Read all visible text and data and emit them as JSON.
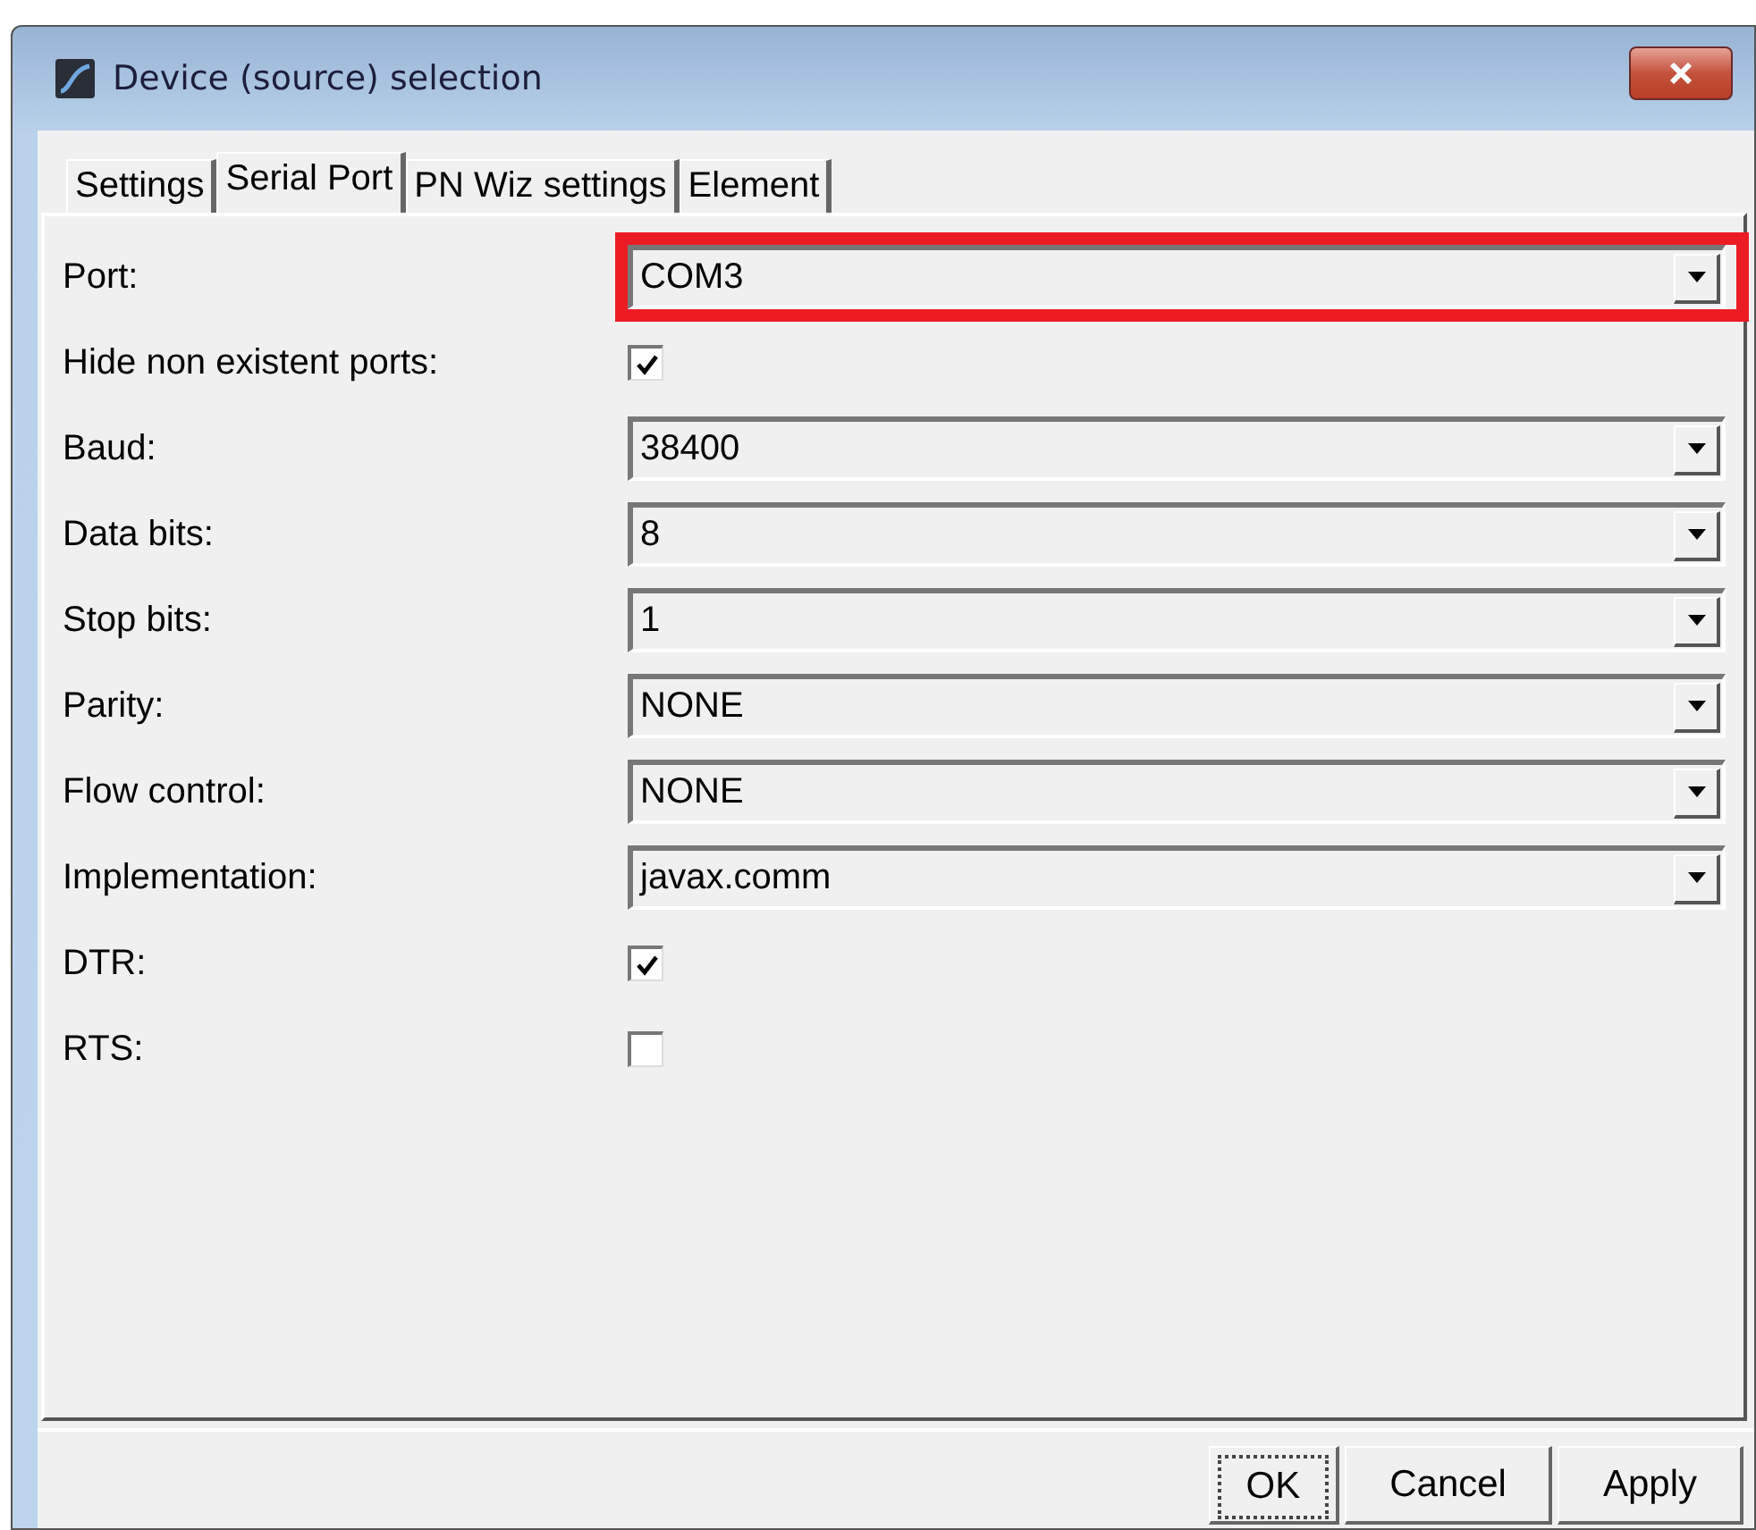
{
  "window": {
    "title": "Device (source) selection"
  },
  "tabs": [
    {
      "label": "Settings",
      "selected": false
    },
    {
      "label": "Serial Port",
      "selected": true
    },
    {
      "label": "PN Wiz settings",
      "selected": false
    },
    {
      "label": "Element",
      "selected": false
    }
  ],
  "fields": [
    {
      "kind": "dropdown",
      "label": "Port:",
      "value": "COM3",
      "highlighted": true
    },
    {
      "kind": "checkbox",
      "label": "Hide non existent ports:",
      "checked": true
    },
    {
      "kind": "dropdown",
      "label": "Baud:",
      "value": "38400",
      "highlighted": false
    },
    {
      "kind": "dropdown",
      "label": "Data bits:",
      "value": "8",
      "highlighted": false
    },
    {
      "kind": "dropdown",
      "label": "Stop bits:",
      "value": "1",
      "highlighted": false
    },
    {
      "kind": "dropdown",
      "label": "Parity:",
      "value": "NONE",
      "highlighted": false
    },
    {
      "kind": "dropdown",
      "label": "Flow control:",
      "value": "NONE",
      "highlighted": false
    },
    {
      "kind": "dropdown",
      "label": "Implementation:",
      "value": "javax.comm",
      "highlighted": false
    },
    {
      "kind": "checkbox",
      "label": "DTR:",
      "checked": true
    },
    {
      "kind": "checkbox",
      "label": "RTS:",
      "checked": false
    }
  ],
  "buttons": [
    {
      "label": "OK",
      "focused": true
    },
    {
      "label": "Cancel",
      "focused": false
    },
    {
      "label": "Apply",
      "focused": false
    }
  ]
}
